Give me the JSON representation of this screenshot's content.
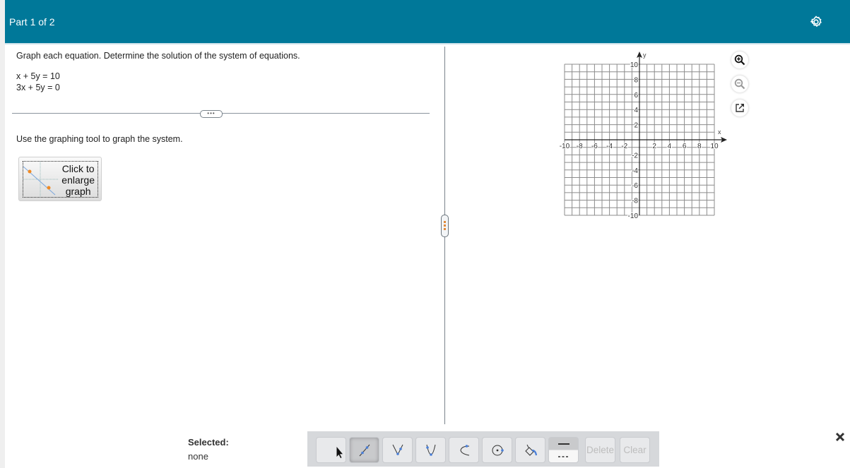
{
  "header": {
    "title": "Part 1 of 2",
    "settings_icon": "gear-icon"
  },
  "question": {
    "instruction": "Graph each equation. Determine the solution  of the system of equations.",
    "equations": [
      "x + 5y = 10",
      "3x + 5y = 0"
    ],
    "graph_prompt": "Use the graphing tool to graph the system.",
    "enlarge_button": [
      "Click to",
      "enlarge",
      "graph"
    ]
  },
  "graph": {
    "x_label": "x",
    "y_label": "y",
    "x_range": [
      -10,
      10
    ],
    "y_range": [
      -10,
      10
    ],
    "grid_step": 1,
    "x_tick_labels": [
      "-10",
      "-8",
      "-6",
      "-4",
      "-2",
      "2",
      "4",
      "6",
      "8",
      "10"
    ],
    "y_tick_labels": [
      "10",
      "8",
      "6",
      "4",
      "2",
      "-2",
      "-4",
      "-6",
      "-8",
      "-10"
    ],
    "side_buttons": [
      "zoom-in-icon",
      "zoom-out-icon",
      "popout-icon"
    ]
  },
  "status": {
    "selected_label": "Selected:",
    "selected_value": "none"
  },
  "toolbar": {
    "tools": [
      "select",
      "line",
      "absolute-value",
      "parabola",
      "square-root",
      "circle",
      "fill",
      "line-style"
    ],
    "active_tool": "line",
    "delete_label": "Delete",
    "clear_label": "Clear"
  },
  "colors": {
    "header": "#007899",
    "accent_point": "#4a7fd8",
    "orange": "#f08a24"
  }
}
